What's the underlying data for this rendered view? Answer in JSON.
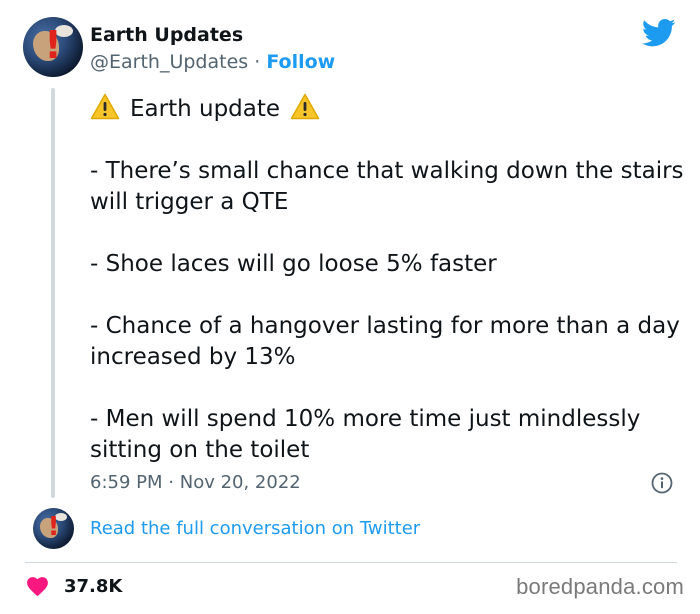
{
  "author": {
    "display_name": "Earth Updates",
    "handle": "@Earth_Updates",
    "separator": "·",
    "follow_label": "Follow",
    "avatar_glyph": "!"
  },
  "tweet": {
    "title": "Earth update",
    "title_icon": "warning-icon",
    "lines": [
      "- There’s small chance that walking down the stairs will trigger a QTE",
      "- Shoe laces will go loose 5% faster",
      "- Chance of a hangover lasting for more than a day increased by 13%",
      "- Men will spend 10% more time just mindlessly sitting on the toilet"
    ],
    "time": "6:59 PM",
    "time_separator": "·",
    "date": "Nov 20, 2022"
  },
  "footer": {
    "read_link": "Read the full conversation on Twitter",
    "likes": "37.8K"
  },
  "watermark": "boredpanda.com",
  "colors": {
    "accent": "#1d9bf0",
    "like": "#f91880",
    "muted": "#536471",
    "warning": "#f7c52a"
  }
}
